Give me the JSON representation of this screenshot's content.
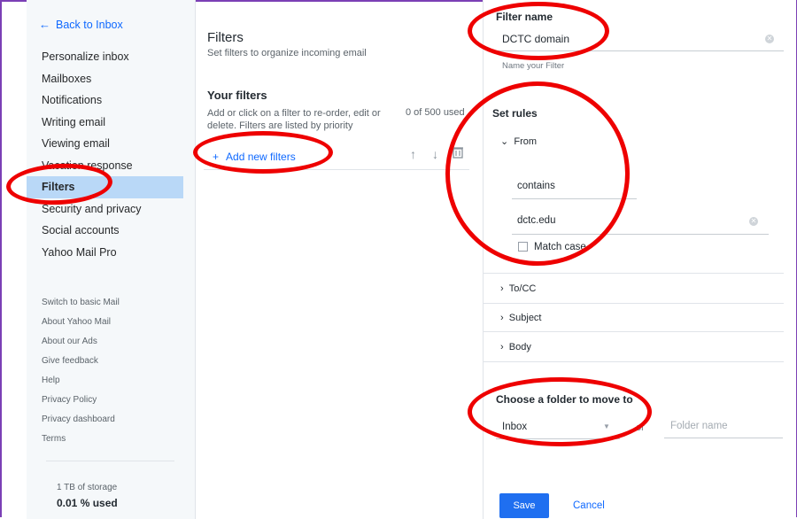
{
  "sidebar": {
    "back_label": "Back to Inbox",
    "items": [
      {
        "label": "Personalize inbox"
      },
      {
        "label": "Mailboxes"
      },
      {
        "label": "Notifications"
      },
      {
        "label": "Writing email"
      },
      {
        "label": "Viewing email"
      },
      {
        "label": "Vacation response"
      },
      {
        "label": "Filters",
        "active": true
      },
      {
        "label": "Security and privacy"
      },
      {
        "label": "Social accounts"
      },
      {
        "label": "Yahoo Mail Pro"
      }
    ],
    "small_links": [
      {
        "label": "Switch to basic Mail"
      },
      {
        "label": "About Yahoo Mail"
      },
      {
        "label": "About our Ads"
      },
      {
        "label": "Give feedback"
      },
      {
        "label": "Help"
      },
      {
        "label": "Privacy Policy"
      },
      {
        "label": "Privacy dashboard"
      },
      {
        "label": "Terms"
      }
    ],
    "storage_label": "1 TB of storage",
    "storage_used": "0.01 % used"
  },
  "main": {
    "title": "Filters",
    "subtitle": "Set filters to organize incoming email",
    "your_filters_heading": "Your filters",
    "description": "Add or click on a filter to re-order, edit or delete. Filters are listed by priority",
    "count": "0 of 500 used",
    "add_filter_label": "Add new filters",
    "icons": [
      "arrow-up-icon",
      "arrow-down-icon",
      "trash-icon"
    ]
  },
  "editor": {
    "filter_name_label": "Filter name",
    "filter_name_value": "DCTC domain",
    "filter_name_hint": "Name your Filter",
    "set_rules_label": "Set rules",
    "rule_from_label": "From",
    "rule_from_operator": "contains",
    "rule_from_value": "dctc.edu",
    "match_case_label": "Match case",
    "rule_tocc_label": "To/CC",
    "rule_subject_label": "Subject",
    "rule_body_label": "Body",
    "folder_heading": "Choose a folder to move to",
    "folder_selected": "Inbox",
    "folder_or": "or",
    "folder_name_placeholder": "Folder name",
    "save_label": "Save",
    "cancel_label": "Cancel"
  },
  "colors": {
    "accent": "#0f69ff",
    "active_nav": "#b9d8f7",
    "annotation": "#ee0000",
    "frame": "#7b3fb5"
  }
}
